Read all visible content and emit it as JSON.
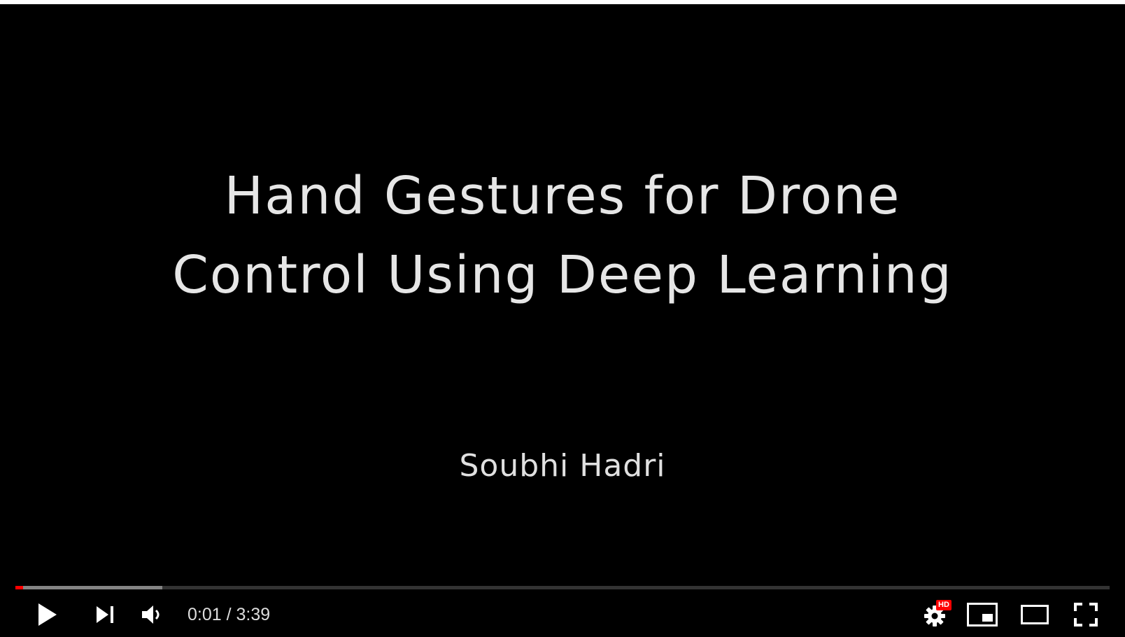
{
  "slide": {
    "title_line1": "Hand Gestures for Drone",
    "title_line2": "Control Using Deep Learning",
    "author": "Soubhi Hadri"
  },
  "player": {
    "current_time": "0:01",
    "separator": " / ",
    "duration": "3:39",
    "played_fraction": 0.007,
    "loaded_fraction": 0.134,
    "settings_badge": "HD",
    "colors": {
      "played": "#ff0000",
      "badge": "#ff0000",
      "background": "#000000"
    },
    "icons": {
      "play": "play-icon",
      "next": "next-icon",
      "volume": "volume-icon",
      "settings": "gear-icon",
      "miniplayer": "miniplayer-icon",
      "theater": "theater-mode-icon",
      "fullscreen": "fullscreen-icon"
    }
  }
}
